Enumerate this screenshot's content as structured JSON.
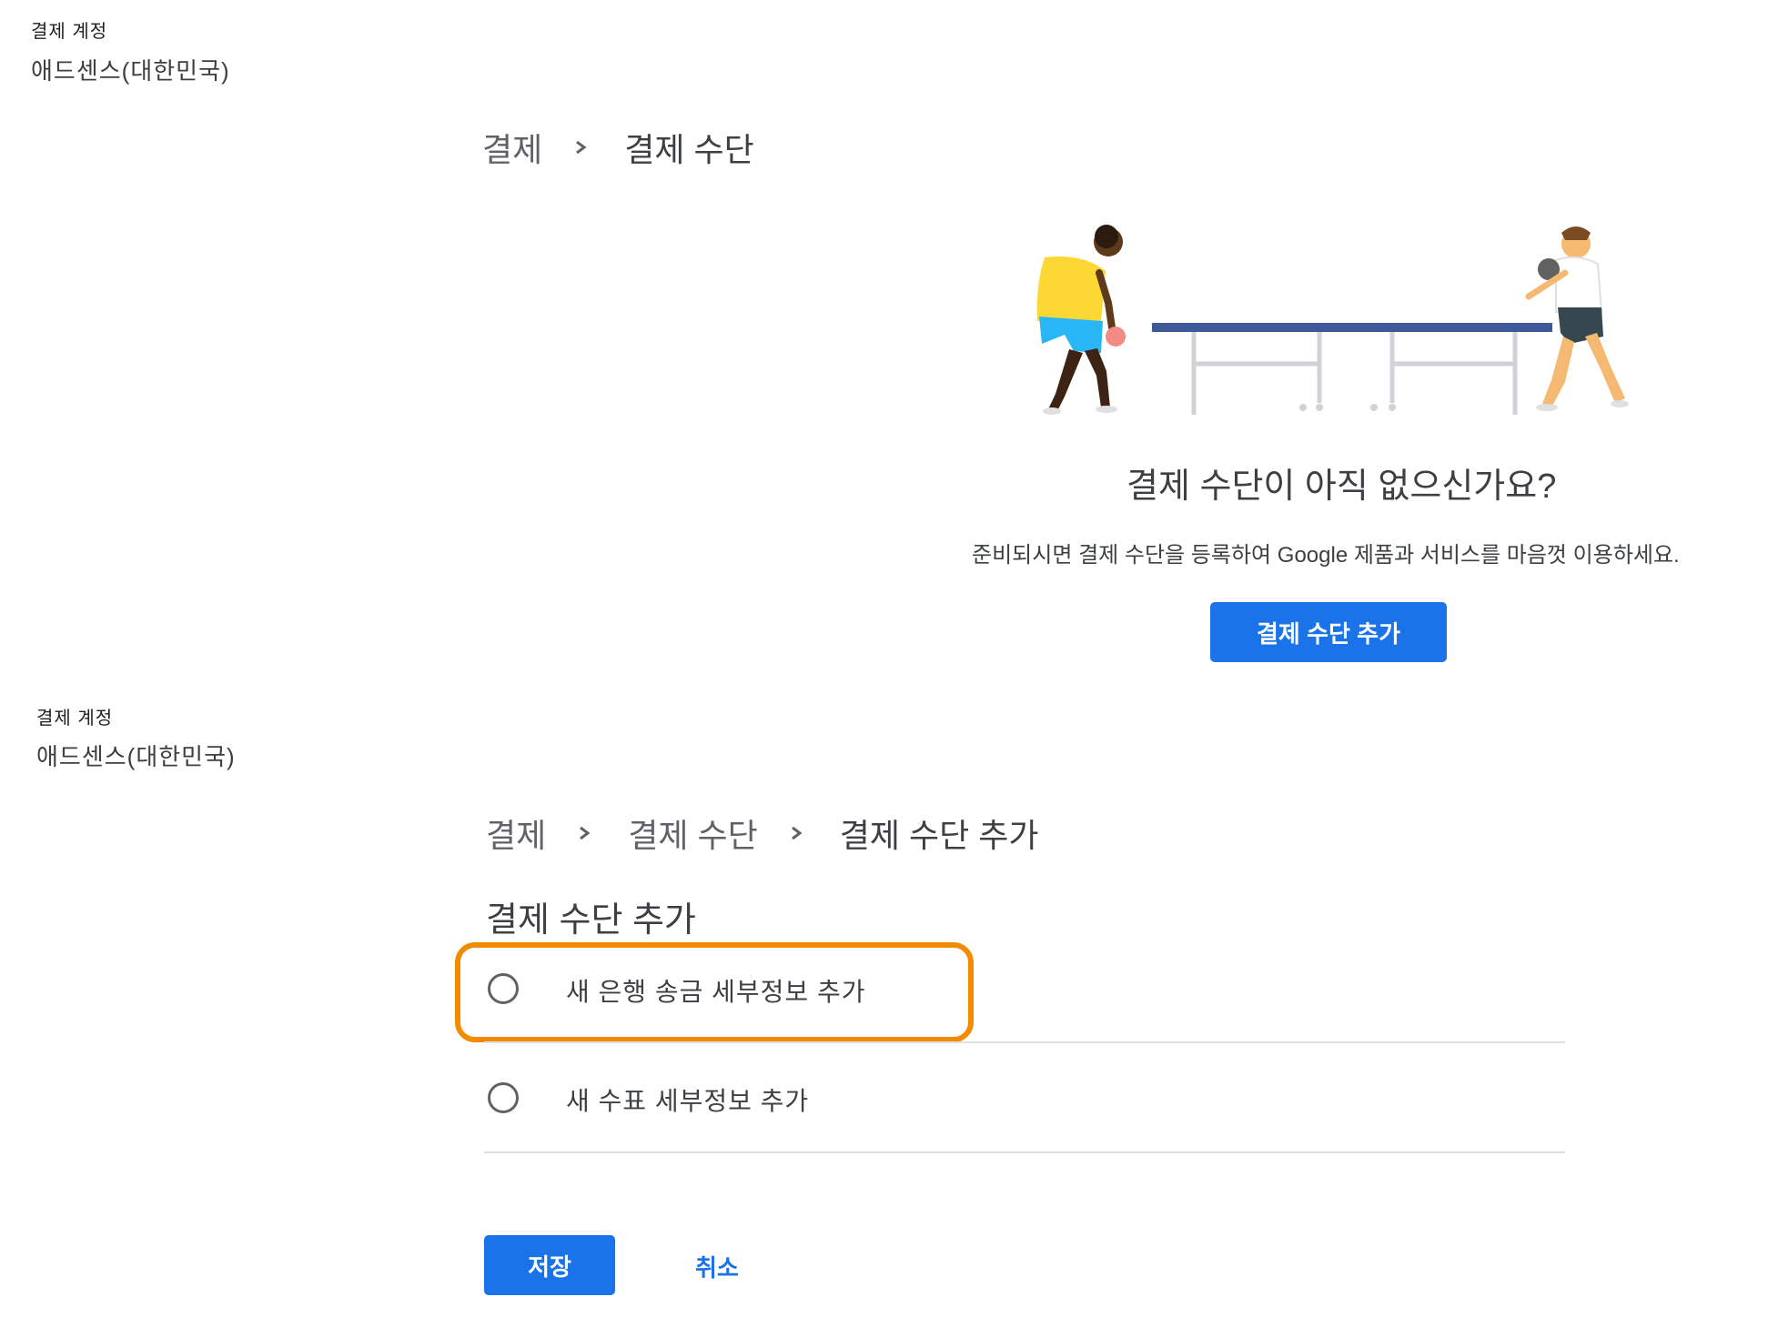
{
  "top": {
    "account_label": "결제 계정",
    "account_name": "애드센스(대한민국)",
    "breadcrumb": [
      "결제",
      "결제 수단"
    ],
    "empty_state": {
      "title": "결제 수단이 아직 없으신가요?",
      "description": "준비되시면 결제 수단을 등록하여 Google 제품과 서비스를 마음껏 이용하세요.",
      "add_button": "결제 수단 추가"
    }
  },
  "bottom": {
    "account_label": "결제 계정",
    "account_name": "애드센스(대한민국)",
    "breadcrumb": [
      "결제",
      "결제 수단",
      "결제 수단 추가"
    ],
    "section_title": "결제 수단 추가",
    "options": [
      {
        "label": "새 은행 송금 세부정보 추가",
        "selected": false,
        "highlighted": true
      },
      {
        "label": "새 수표 세부정보 추가",
        "selected": false,
        "highlighted": false
      }
    ],
    "save_button": "저장",
    "cancel_button": "취소"
  },
  "colors": {
    "primary": "#1a73e8",
    "highlight": "#f28b00",
    "shirt_yellow": "#fdd835",
    "shorts_blue": "#29b6f6",
    "paddle_red": "#f28b82",
    "table_blue": "#3c5a99"
  },
  "illustration": "two-people-playing-table-tennis"
}
